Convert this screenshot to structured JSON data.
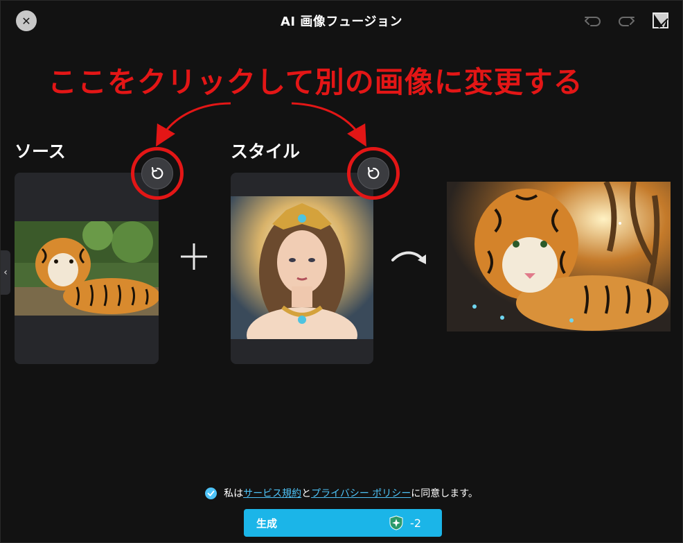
{
  "header": {
    "title": "AI 画像フュージョン",
    "close_icon": "close-icon",
    "undo_icon": "undo-icon",
    "redo_icon": "redo-icon",
    "note_icon": "note-icon"
  },
  "annotation": {
    "text": "ここをクリックして別の画像に変更する",
    "color": "#e31616"
  },
  "source": {
    "label": "ソース",
    "reset_icon": "reset-icon"
  },
  "style": {
    "label": "スタイル",
    "reset_icon": "reset-icon"
  },
  "agreement": {
    "prefix": "私は",
    "terms_link": "サービス規約",
    "conjunction": "と",
    "privacy_link": "プライバシー ポリシー",
    "suffix": "に同意します。",
    "checked": true
  },
  "generate": {
    "label": "生成",
    "cost": "-2",
    "icon": "credit-icon"
  },
  "colors": {
    "accent": "#1bb5e8",
    "link": "#4ec3f7",
    "background": "#121212",
    "card": "#26272b"
  }
}
